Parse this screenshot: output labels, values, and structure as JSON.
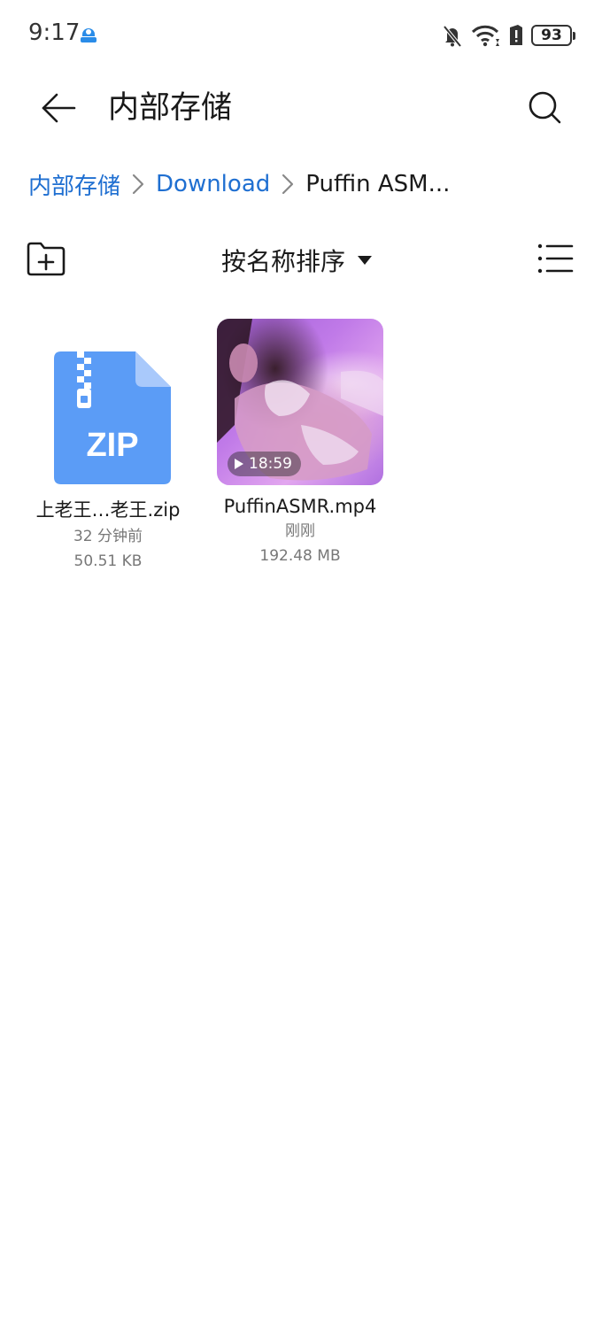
{
  "status_bar": {
    "time": "9:17",
    "battery": "93"
  },
  "header": {
    "title": "内部存储"
  },
  "breadcrumb": {
    "items": [
      "内部存储",
      "Download",
      "Puffin ASM..."
    ]
  },
  "toolbar": {
    "sort_label": "按名称排序"
  },
  "files": [
    {
      "name": "上老王…老王.zip",
      "time": "32 分钟前",
      "size": "50.51 KB",
      "icon": "zip-file-icon",
      "icon_text": "ZIP"
    },
    {
      "name": "PuffinASMR.mp4",
      "time": "刚刚",
      "size": "192.48 MB",
      "icon": "video-thumbnail",
      "duration": "18:59"
    }
  ],
  "colors": {
    "accent": "#1f6fd1",
    "zip_icon": "#5b9cf6",
    "zip_fold": "#a9c9fb"
  }
}
